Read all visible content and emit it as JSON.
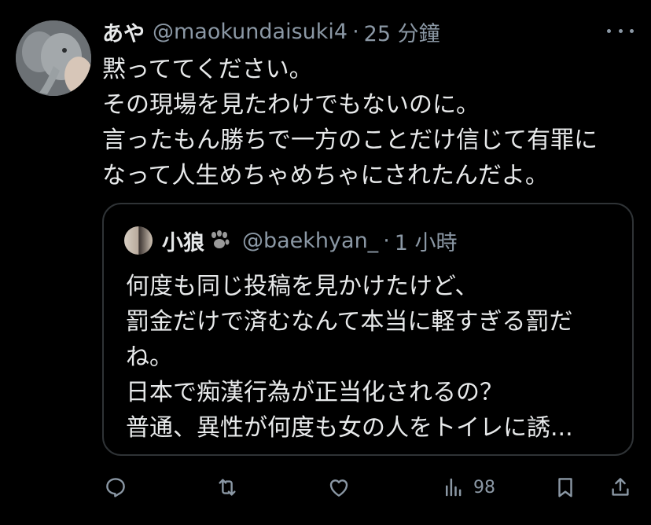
{
  "tweet": {
    "display_name": "あや",
    "handle": "@maokundaisuki4",
    "separator": "·",
    "time": "25 分鐘",
    "body_lines": [
      "黙っててください。",
      "その現場を見たわけでもないのに。",
      "言ったもん勝ちで一方のことだけ信じて有罪に",
      "なって人生めちゃめちゃにされたんだよ。"
    ]
  },
  "quote": {
    "display_name": "小狼",
    "handle": "@baekhyan_",
    "separator": "·",
    "time": "1 小時",
    "body_lines": [
      "何度も同じ投稿を見かけたけど、",
      "罰金だけで済むなんて本当に軽すぎる罰だ",
      "ね。",
      "日本で痴漢行為が正当化されるの？",
      "普通、異性が何度も女の人をトイレに誘..."
    ]
  },
  "actions": {
    "views": "98",
    "icons": [
      "reply-icon",
      "retweet-icon",
      "like-icon",
      "views-icon",
      "bookmark-icon",
      "share-icon"
    ]
  },
  "colors": {
    "background": "#000000",
    "text": "#e7e9ea",
    "secondary": "#8b98a5",
    "border": "#2f3336"
  }
}
